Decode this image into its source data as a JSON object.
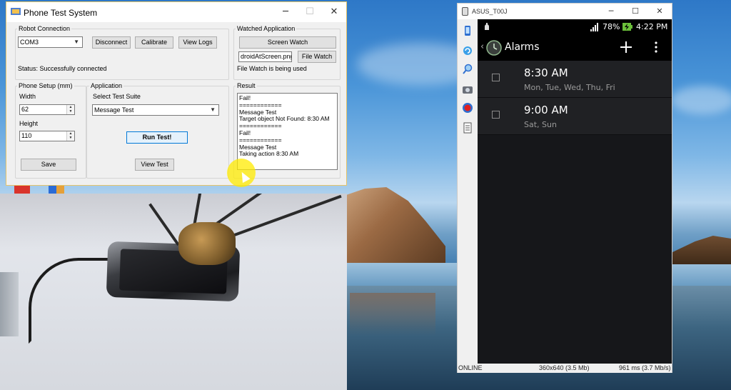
{
  "colors": {
    "focus_blue": "#0078d7",
    "android_dark": "#16171a",
    "cursor_highlight": "#ffeb00",
    "record_red": "#e02020"
  },
  "pts": {
    "title": "Phone Test System",
    "caption": {
      "minimize": "─",
      "maximize": "☐",
      "close": "✕"
    },
    "robot": {
      "group_label": "Robot Connection",
      "port_value": "COM3",
      "disconnect_label": "Disconnect",
      "calibrate_label": "Calibrate",
      "view_logs_label": "View Logs",
      "status_text": "Status: Successfully connected"
    },
    "watched": {
      "group_label": "Watched Application",
      "screen_watch_label": "Screen Watch",
      "file_value": "droidAtScreen.png",
      "file_watch_label": "File Watch",
      "status_text": "File Watch is being used"
    },
    "phone_setup": {
      "group_label": "Phone Setup (mm)",
      "width_label": "Width",
      "width_value": "62",
      "height_label": "Height",
      "height_value": "110",
      "save_label": "Save"
    },
    "application": {
      "group_label": "Application",
      "suite_label": "Select Test Suite",
      "suite_value": "Message Test",
      "run_label": "Run Test!",
      "view_label": "View Test"
    },
    "result": {
      "group_label": "Result",
      "lines": [
        "Fail!",
        "============",
        "Message Test",
        "Target object Not Found: 8:30 AM",
        "============",
        "Fail!",
        "============",
        "Message Test",
        "Taking action 8:30 AM"
      ]
    }
  },
  "asus": {
    "title": "ASUS_T00J",
    "caption": {
      "minimize": "─",
      "maximize": "☐",
      "close": "✕"
    },
    "tools": [
      "phone-icon",
      "rotate-icon",
      "zoom-icon",
      "camera-icon",
      "record-icon",
      "document-icon"
    ],
    "statusbar": {
      "battery": "78%",
      "time": "4:22 PM"
    },
    "actionbar": {
      "title": "Alarms"
    },
    "alarms": [
      {
        "time": "8:30 AM",
        "days": "Mon, Tue, Wed, Thu, Fri"
      },
      {
        "time": "9:00 AM",
        "days": "Sat, Sun"
      }
    ],
    "status": {
      "state": "ONLINE",
      "resolution": "360x640 (3.5 Mb)",
      "latency": "961 ms (3.7 Mb/s)"
    }
  }
}
